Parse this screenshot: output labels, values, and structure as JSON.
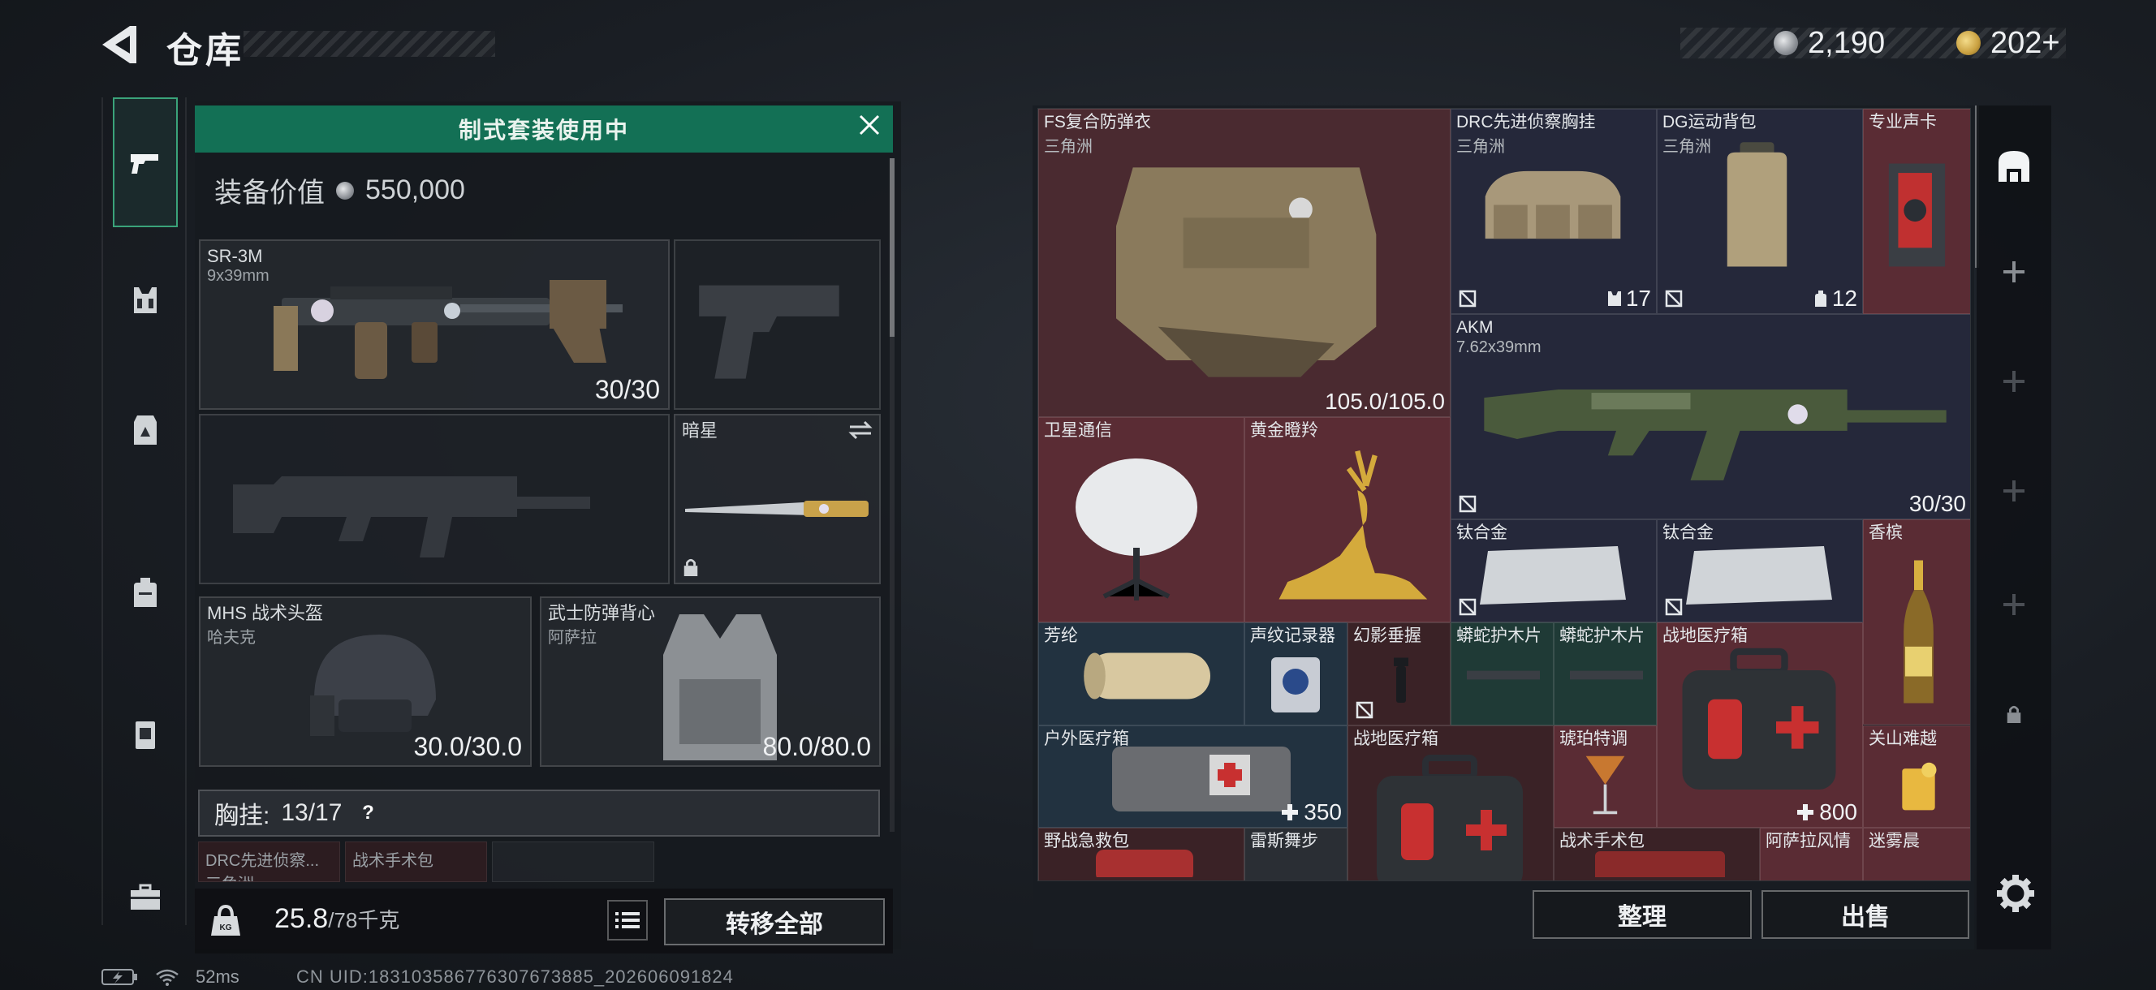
{
  "header": {
    "title": "仓库",
    "currencies": [
      {
        "icon": "silver-coin-icon",
        "value": "2,190"
      },
      {
        "icon": "gold-coin-icon",
        "value": "202+"
      }
    ]
  },
  "sidebar": {
    "tabs": [
      {
        "icon": "pistol-icon",
        "active": true
      },
      {
        "icon": "chest-rig-icon",
        "active": false
      },
      {
        "icon": "vest-icon",
        "active": false
      },
      {
        "icon": "backpack-icon",
        "active": false
      },
      {
        "icon": "case-icon",
        "active": false
      },
      {
        "icon": "toolbox-icon",
        "active": false
      }
    ]
  },
  "loadout": {
    "banner": "制式套装使用中",
    "equip_value_label": "装备价值",
    "equip_value": "550,000",
    "primary": {
      "name": "SR-3M",
      "caliber": "9x39mm",
      "ammo": "30/30"
    },
    "melee": {
      "name": "暗星"
    },
    "helmet": {
      "name": "MHS 战术头盔",
      "sub": "哈夫克",
      "durability": "30.0/30.0"
    },
    "armor": {
      "name": "武士防弹背心",
      "sub": "阿萨拉",
      "durability": "80.0/80.0"
    },
    "chest_label": "胸挂:",
    "chest_capacity": "13/17",
    "chest_help": "?",
    "mini_items": [
      "DRC先进侦察...",
      "战术手术包"
    ],
    "mini_sub": "三角洲",
    "weight": "25.8",
    "weight_max": "/78千克",
    "weight_icon_label": "KG",
    "transfer_all": "转移全部"
  },
  "inventory": {
    "items": {
      "fs_armor": {
        "name": "FS复合防弹衣",
        "sub": "三角洲",
        "value": "105.0/105.0"
      },
      "drc_rig": {
        "name": "DRC先进侦察胸挂",
        "sub": "三角洲",
        "value": "17"
      },
      "dg_pack": {
        "name": "DG运动背包",
        "sub": "三角洲",
        "value": "12"
      },
      "sound_card": {
        "name": "专业声卡"
      },
      "akm": {
        "name": "AKM",
        "sub": "7.62x39mm",
        "value": "30/30"
      },
      "sat_comm": {
        "name": "卫星通信"
      },
      "golden_deer": {
        "name": "黄金瞪羚"
      },
      "titanium_1": {
        "name": "钛合金"
      },
      "titanium_2": {
        "name": "钛合金"
      },
      "champagne": {
        "name": "香槟"
      },
      "aramid": {
        "name": "芳纶"
      },
      "voice_rec": {
        "name": "声纹记录器"
      },
      "phantom_grip": {
        "name": "幻影垂握"
      },
      "viper_1": {
        "name": "蟒蛇护木片"
      },
      "viper_2": {
        "name": "蟒蛇护木片"
      },
      "field_med_1": {
        "name": "战地医疗箱",
        "value": "800"
      },
      "outdoor_med": {
        "name": "户外医疗箱",
        "value": "350"
      },
      "field_med_2": {
        "name": "战地医疗箱"
      },
      "amber_drink": {
        "name": "琥珀特调"
      },
      "guanshan": {
        "name": "关山难越"
      },
      "field_aid": {
        "name": "野战急救包"
      },
      "rhys_dance": {
        "name": "雷斯舞步"
      },
      "surgery_kit": {
        "name": "战术手术包"
      },
      "asala_style": {
        "name": "阿萨拉风情"
      },
      "mist_morning": {
        "name": "迷雾晨"
      }
    },
    "sort": "整理",
    "sell": "出售"
  },
  "status": {
    "ping": "52ms",
    "uid": "CN UID:183103586776307673885_202606091824"
  }
}
